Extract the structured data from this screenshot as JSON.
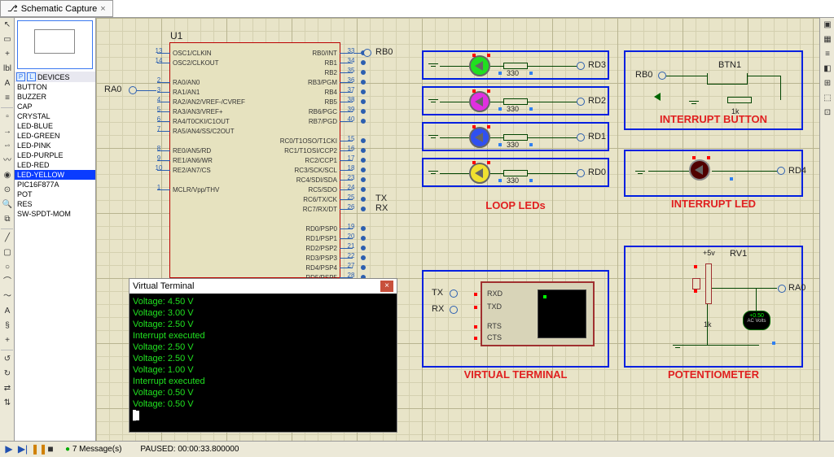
{
  "tab": {
    "label": "Schematic Capture",
    "close": "×"
  },
  "devices_header": "DEVICES",
  "devices": [
    "BUTTON",
    "BUZZER",
    "CAP",
    "CRYSTAL",
    "LED-BLUE",
    "LED-GREEN",
    "LED-PINK",
    "LED-PURPLE",
    "LED-RED",
    "LED-YELLOW",
    "PIC16F877A",
    "POT",
    "RES",
    "SW-SPDT-MOM"
  ],
  "selected_device": "LED-YELLOW",
  "chip_ref": "U1",
  "left_pins": [
    {
      "n": "13",
      "t": "OSC1/CLKIN"
    },
    {
      "n": "14",
      "t": "OSC2/CLKOUT"
    },
    {
      "n": "",
      "t": ""
    },
    {
      "n": "2",
      "t": "RA0/AN0"
    },
    {
      "n": "3",
      "t": "RA1/AN1"
    },
    {
      "n": "4",
      "t": "RA2/AN2/VREF-/CVREF"
    },
    {
      "n": "5",
      "t": "RA3/AN3/VREF+"
    },
    {
      "n": "6",
      "t": "RA4/T0CKI/C1OUT"
    },
    {
      "n": "7",
      "t": "RA5/AN4/SS/C2OUT"
    },
    {
      "n": "",
      "t": ""
    },
    {
      "n": "8",
      "t": "RE0/AN5/RD"
    },
    {
      "n": "9",
      "t": "RE1/AN6/WR"
    },
    {
      "n": "10",
      "t": "RE2/AN7/CS"
    },
    {
      "n": "",
      "t": ""
    },
    {
      "n": "1",
      "t": "MCLR/Vpp/THV"
    }
  ],
  "right_pins": [
    {
      "n": "33",
      "t": "RB0/INT"
    },
    {
      "n": "34",
      "t": "RB1"
    },
    {
      "n": "35",
      "t": "RB2"
    },
    {
      "n": "36",
      "t": "RB3/PGM"
    },
    {
      "n": "37",
      "t": "RB4"
    },
    {
      "n": "38",
      "t": "RB5"
    },
    {
      "n": "39",
      "t": "RB6/PGC"
    },
    {
      "n": "40",
      "t": "RB7/PGD"
    },
    {
      "n": "",
      "t": ""
    },
    {
      "n": "15",
      "t": "RC0/T1OSO/T1CKI"
    },
    {
      "n": "16",
      "t": "RC1/T1OSI/CCP2"
    },
    {
      "n": "17",
      "t": "RC2/CCP1"
    },
    {
      "n": "18",
      "t": "RC3/SCK/SCL"
    },
    {
      "n": "23",
      "t": "RC4/SDI/SDA"
    },
    {
      "n": "24",
      "t": "RC5/SDO"
    },
    {
      "n": "25",
      "t": "RC6/TX/CK"
    },
    {
      "n": "26",
      "t": "RC7/RX/DT"
    },
    {
      "n": "",
      "t": ""
    },
    {
      "n": "19",
      "t": "RD0/PSP0"
    },
    {
      "n": "20",
      "t": "RD1/PSP1"
    },
    {
      "n": "21",
      "t": "RD2/PSP2"
    },
    {
      "n": "22",
      "t": "RD3/PSP3"
    },
    {
      "n": "27",
      "t": "RD4/PSP4"
    },
    {
      "n": "28",
      "t": "RD5/PSP5"
    }
  ],
  "ra0_label": "RA0",
  "rb0_label": "RB0",
  "tx_label": "TX",
  "rx_label": "RX",
  "rd_labels": [
    "RD0",
    "RD1",
    "RD2",
    "RD3",
    "RD4"
  ],
  "loop": {
    "title": "LOOP LEDs",
    "res": "330",
    "rows": [
      {
        "color": "led-g",
        "net": "RD3"
      },
      {
        "color": "led-m",
        "net": "RD2"
      },
      {
        "color": "led-b",
        "net": "RD1"
      },
      {
        "color": "led-y",
        "net": "RD0"
      }
    ]
  },
  "int_btn": {
    "title": "INTERRUPT BUTTON",
    "net": "RB0",
    "comp": "BTN1",
    "res": "1k"
  },
  "int_led": {
    "title": "INTERRUPT LED",
    "net": "RD4"
  },
  "vt_block": {
    "title": "VIRTUAL TERMINAL",
    "pins": [
      "RXD",
      "TXD",
      "RTS",
      "CTS"
    ],
    "tx": "TX",
    "rx": "RX"
  },
  "pot": {
    "title": "POTENTIOMETER",
    "ref": "RV1",
    "res": "1k",
    "v": "+5v",
    "net": "RA0",
    "meter_v": "+0.50",
    "meter_l": "AC Volts"
  },
  "vt_win": {
    "title": "Virtual Terminal",
    "lines": [
      "Voltage: 4.50 V",
      "Voltage: 3.00 V",
      "Voltage: 2.50 V",
      "Interrupt executed",
      "Voltage: 2.50 V",
      "Voltage: 2.50 V",
      "Voltage: 1.00 V",
      "Interrupt executed",
      "Voltage: 0.50 V",
      "Voltage: 0.50 V"
    ]
  },
  "status": {
    "msgs": "7 Message(s)",
    "state": "PAUSED: 00:00:33.800000",
    "play": "▶",
    "step": "▶|",
    "pause": "❚❚",
    "stop": "■"
  }
}
